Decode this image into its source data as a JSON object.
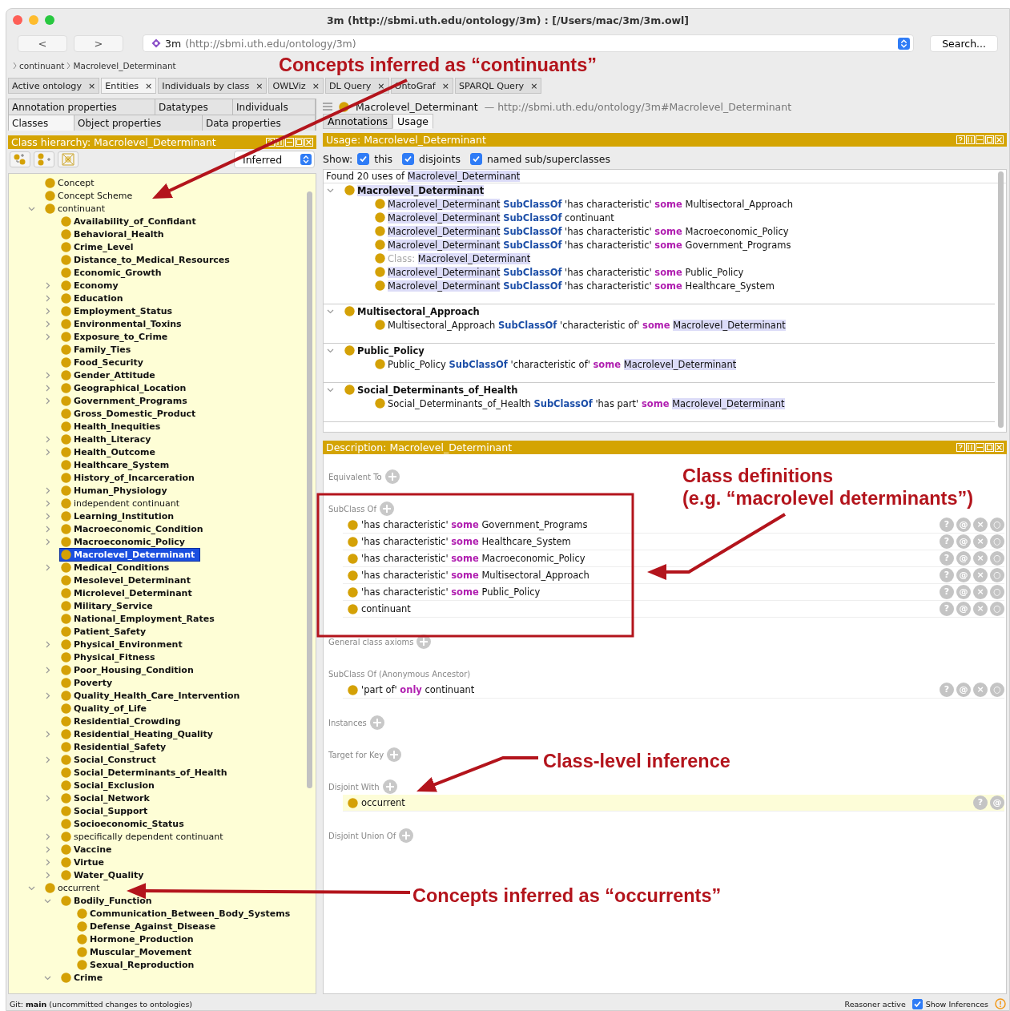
{
  "window": {
    "title": "3m (http://sbmi.uth.edu/ontology/3m)  : [/Users/mac/3m/3m.owl]"
  },
  "toolbar": {
    "back": "<",
    "forward": ">",
    "ontology_name": "3m",
    "ontology_iri": "(http://sbmi.uth.edu/ontology/3m)",
    "search": "Search..."
  },
  "breadcrumb": [
    "continuant",
    "Macrolevel_Determinant"
  ],
  "tabs": [
    {
      "label": "Active ontology",
      "close": "×",
      "selected": false
    },
    {
      "label": "Entities",
      "close": "×",
      "selected": true
    },
    {
      "label": "Individuals by class",
      "close": "×",
      "selected": false
    },
    {
      "label": "OWLViz",
      "close": "×",
      "selected": false
    },
    {
      "label": "DL Query",
      "close": "×",
      "selected": false
    },
    {
      "label": "OntoGraf",
      "close": "×",
      "selected": false
    },
    {
      "label": "SPARQL Query",
      "close": "×",
      "selected": false
    }
  ],
  "left_panel": {
    "tab_rows": [
      [
        {
          "label": "Annotation properties",
          "selected": false
        },
        {
          "label": "Datatypes",
          "selected": false
        },
        {
          "label": "Individuals",
          "selected": false
        }
      ],
      [
        {
          "label": "Classes",
          "selected": true
        },
        {
          "label": "Object properties",
          "selected": false
        },
        {
          "label": "Data properties",
          "selected": false
        }
      ]
    ],
    "title": "Class hierarchy: Macrolevel_Determinant",
    "mode": "Inferred",
    "tree": [
      {
        "label": "Concept",
        "kind": "imported",
        "selected": false
      },
      {
        "label": "Concept Scheme",
        "kind": "imported",
        "selected": false
      },
      {
        "label": "continuant",
        "kind": "imported",
        "selected": false,
        "expanded": true,
        "children": [
          {
            "label": "Availability_of_Confidant",
            "kind": "named",
            "selected": false
          },
          {
            "label": "Behavioral_Health",
            "kind": "named",
            "selected": false
          },
          {
            "label": "Crime_Level",
            "kind": "named",
            "selected": false
          },
          {
            "label": "Distance_to_Medical_Resources",
            "kind": "named",
            "selected": false
          },
          {
            "label": "Economic_Growth",
            "kind": "named",
            "selected": false
          },
          {
            "label": "Economy",
            "kind": "named",
            "selected": false,
            "expanded": false
          },
          {
            "label": "Education",
            "kind": "named",
            "selected": false,
            "expanded": false
          },
          {
            "label": "Employment_Status",
            "kind": "named",
            "selected": false,
            "expanded": false
          },
          {
            "label": "Environmental_Toxins",
            "kind": "named",
            "selected": false,
            "expanded": false
          },
          {
            "label": "Exposure_to_Crime",
            "kind": "named",
            "selected": false,
            "expanded": false
          },
          {
            "label": "Family_Ties",
            "kind": "named",
            "selected": false
          },
          {
            "label": "Food_Security",
            "kind": "named",
            "selected": false
          },
          {
            "label": "Gender_Attitude",
            "kind": "named",
            "selected": false,
            "expanded": false
          },
          {
            "label": "Geographical_Location",
            "kind": "named",
            "selected": false,
            "expanded": false
          },
          {
            "label": "Government_Programs",
            "kind": "named",
            "selected": false,
            "expanded": false
          },
          {
            "label": "Gross_Domestic_Product",
            "kind": "named",
            "selected": false
          },
          {
            "label": "Health_Inequities",
            "kind": "named",
            "selected": false
          },
          {
            "label": "Health_Literacy",
            "kind": "named",
            "selected": false,
            "expanded": false
          },
          {
            "label": "Health_Outcome",
            "kind": "named",
            "selected": false,
            "expanded": false
          },
          {
            "label": "Healthcare_System",
            "kind": "named",
            "selected": false
          },
          {
            "label": "History_of_Incarceration",
            "kind": "named",
            "selected": false
          },
          {
            "label": "Human_Physiology",
            "kind": "named",
            "selected": false,
            "expanded": false
          },
          {
            "label": "independent continuant",
            "kind": "imported",
            "selected": false,
            "expanded": false
          },
          {
            "label": "Learning_Institution",
            "kind": "named",
            "selected": false,
            "expanded": false
          },
          {
            "label": "Macroeconomic_Condition",
            "kind": "named",
            "selected": false,
            "expanded": false
          },
          {
            "label": "Macroeconomic_Policy",
            "kind": "named",
            "selected": false,
            "expanded": false
          },
          {
            "label": "Macrolevel_Determinant",
            "kind": "named",
            "selected": true
          },
          {
            "label": "Medical_Conditions",
            "kind": "named",
            "selected": false,
            "expanded": false
          },
          {
            "label": "Mesolevel_Determinant",
            "kind": "named",
            "selected": false
          },
          {
            "label": "Microlevel_Determinant",
            "kind": "named",
            "selected": false
          },
          {
            "label": "Military_Service",
            "kind": "named",
            "selected": false
          },
          {
            "label": "National_Employment_Rates",
            "kind": "named",
            "selected": false
          },
          {
            "label": "Patient_Safety",
            "kind": "named",
            "selected": false
          },
          {
            "label": "Physical_Environment",
            "kind": "named",
            "selected": false,
            "expanded": false
          },
          {
            "label": "Physical_Fitness",
            "kind": "named",
            "selected": false
          },
          {
            "label": "Poor_Housing_Condition",
            "kind": "named",
            "selected": false,
            "expanded": false
          },
          {
            "label": "Poverty",
            "kind": "named",
            "selected": false
          },
          {
            "label": "Quality_Health_Care_Intervention",
            "kind": "named",
            "selected": false,
            "expanded": false
          },
          {
            "label": "Quality_of_Life",
            "kind": "named",
            "selected": false
          },
          {
            "label": "Residential_Crowding",
            "kind": "named",
            "selected": false
          },
          {
            "label": "Residential_Heating_Quality",
            "kind": "named",
            "selected": false,
            "expanded": false
          },
          {
            "label": "Residential_Safety",
            "kind": "named",
            "selected": false
          },
          {
            "label": "Social_Construct",
            "kind": "named",
            "selected": false,
            "expanded": false
          },
          {
            "label": "Social_Determinants_of_Health",
            "kind": "named",
            "selected": false
          },
          {
            "label": "Social_Exclusion",
            "kind": "named",
            "selected": false
          },
          {
            "label": "Social_Network",
            "kind": "named",
            "selected": false,
            "expanded": false
          },
          {
            "label": "Social_Support",
            "kind": "named",
            "selected": false
          },
          {
            "label": "Socioeconomic_Status",
            "kind": "named",
            "selected": false
          },
          {
            "label": "specifically dependent continuant",
            "kind": "imported",
            "selected": false,
            "expanded": false
          },
          {
            "label": "Vaccine",
            "kind": "named",
            "selected": false,
            "expanded": false
          },
          {
            "label": "Virtue",
            "kind": "named",
            "selected": false,
            "expanded": false
          },
          {
            "label": "Water_Quality",
            "kind": "named",
            "selected": false,
            "expanded": false
          }
        ]
      },
      {
        "label": "occurrent",
        "kind": "imported",
        "selected": false,
        "expanded": true,
        "children": [
          {
            "label": "Bodily_Function",
            "kind": "named",
            "selected": false,
            "expanded": true,
            "children": [
              {
                "label": "Communication_Between_Body_Systems",
                "kind": "named",
                "selected": false
              },
              {
                "label": "Defense_Against_Disease",
                "kind": "named",
                "selected": false
              },
              {
                "label": "Hormone_Production",
                "kind": "named",
                "selected": false
              },
              {
                "label": "Muscular_Movement",
                "kind": "named",
                "selected": false
              },
              {
                "label": "Sexual_Reproduction",
                "kind": "named",
                "selected": false
              }
            ]
          },
          {
            "label": "Crime",
            "kind": "named",
            "selected": false,
            "expanded": true
          }
        ]
      }
    ]
  },
  "entity_header": {
    "name": "Macrolevel_Determinant",
    "iri": "— http://sbmi.uth.edu/ontology/3m#Macrolevel_Determinant"
  },
  "right_tabs": [
    {
      "label": "Annotations",
      "selected": false
    },
    {
      "label": "Usage",
      "selected": true
    }
  ],
  "usage": {
    "title": "Usage: Macrolevel_Determinant",
    "show_label": "Show:",
    "filters": [
      {
        "label": "this",
        "checked": true
      },
      {
        "label": "disjoints",
        "checked": true
      },
      {
        "label": "named sub/superclasses",
        "checked": true
      }
    ],
    "summary": [
      {
        "kind": "text",
        "text": "Found 20 uses of"
      },
      {
        "kind": "entity",
        "text": "Macrolevel_Determinant"
      }
    ],
    "groups": [
      {
        "header": {
          "kind": "entity",
          "text": "Macrolevel_Determinant"
        },
        "expanded": true,
        "axioms": [
          [
            {
              "kind": "entity",
              "text": "Macrolevel_Determinant"
            },
            {
              "kind": "keyword",
              "text": "SubClassOf"
            },
            {
              "kind": "text",
              "text": "'has characteristic'"
            },
            {
              "kind": "quantifier",
              "text": "some"
            },
            {
              "kind": "text",
              "text": "Multisectoral_Approach"
            }
          ],
          [
            {
              "kind": "entity",
              "text": "Macrolevel_Determinant"
            },
            {
              "kind": "keyword",
              "text": "SubClassOf"
            },
            {
              "kind": "text",
              "text": "continuant"
            }
          ],
          [
            {
              "kind": "entity",
              "text": "Macrolevel_Determinant"
            },
            {
              "kind": "keyword",
              "text": "SubClassOf"
            },
            {
              "kind": "text",
              "text": "'has characteristic'"
            },
            {
              "kind": "quantifier",
              "text": "some"
            },
            {
              "kind": "text",
              "text": "Macroeconomic_Policy"
            }
          ],
          [
            {
              "kind": "entity",
              "text": "Macrolevel_Determinant"
            },
            {
              "kind": "keyword",
              "text": "SubClassOf"
            },
            {
              "kind": "text",
              "text": "'has characteristic'"
            },
            {
              "kind": "quantifier",
              "text": "some"
            },
            {
              "kind": "text",
              "text": "Government_Programs"
            }
          ],
          [
            {
              "kind": "label",
              "text": "Class:"
            },
            {
              "kind": "entity",
              "text": "Macrolevel_Determinant"
            }
          ],
          [
            {
              "kind": "entity",
              "text": "Macrolevel_Determinant"
            },
            {
              "kind": "keyword",
              "text": "SubClassOf"
            },
            {
              "kind": "text",
              "text": "'has characteristic'"
            },
            {
              "kind": "quantifier",
              "text": "some"
            },
            {
              "kind": "text",
              "text": "Public_Policy"
            }
          ],
          [
            {
              "kind": "entity",
              "text": "Macrolevel_Determinant"
            },
            {
              "kind": "keyword",
              "text": "SubClassOf"
            },
            {
              "kind": "text",
              "text": "'has characteristic'"
            },
            {
              "kind": "quantifier",
              "text": "some"
            },
            {
              "kind": "text",
              "text": "Healthcare_System"
            }
          ]
        ]
      },
      {
        "header": {
          "kind": "text",
          "text": "Multisectoral_Approach"
        },
        "expanded": true,
        "axioms": [
          [
            {
              "kind": "text",
              "text": "Multisectoral_Approach"
            },
            {
              "kind": "keyword",
              "text": "SubClassOf"
            },
            {
              "kind": "text",
              "text": "'characteristic of'"
            },
            {
              "kind": "quantifier",
              "text": "some"
            },
            {
              "kind": "entity",
              "text": "Macrolevel_Determinant"
            }
          ]
        ]
      },
      {
        "header": {
          "kind": "text",
          "text": "Public_Policy"
        },
        "expanded": true,
        "axioms": [
          [
            {
              "kind": "text",
              "text": "Public_Policy"
            },
            {
              "kind": "keyword",
              "text": "SubClassOf"
            },
            {
              "kind": "text",
              "text": "'characteristic of'"
            },
            {
              "kind": "quantifier",
              "text": "some"
            },
            {
              "kind": "entity",
              "text": "Macrolevel_Determinant"
            }
          ]
        ]
      },
      {
        "header": {
          "kind": "text",
          "text": "Social_Determinants_of_Health"
        },
        "expanded": true,
        "axioms": [
          [
            {
              "kind": "text",
              "text": "Social_Determinants_of_Health"
            },
            {
              "kind": "keyword",
              "text": "SubClassOf"
            },
            {
              "kind": "text",
              "text": "'has part'"
            },
            {
              "kind": "quantifier",
              "text": "some"
            },
            {
              "kind": "entity",
              "text": "Macrolevel_Determinant"
            }
          ]
        ]
      }
    ]
  },
  "description": {
    "title": "Description: Macrolevel_Determinant",
    "sections": [
      {
        "label": "Equivalent To",
        "add": true
      },
      {
        "label": "SubClass Of",
        "add": true,
        "items": [
          {
            "inferred": false,
            "actions": [
              "?",
              "@",
              "×",
              "○"
            ],
            "tokens": [
              {
                "kind": "text",
                "text": "'has characteristic'"
              },
              {
                "kind": "quantifier",
                "text": "some"
              },
              {
                "kind": "text",
                "text": "Government_Programs"
              }
            ]
          },
          {
            "inferred": false,
            "actions": [
              "?",
              "@",
              "×",
              "○"
            ],
            "tokens": [
              {
                "kind": "text",
                "text": "'has characteristic'"
              },
              {
                "kind": "quantifier",
                "text": "some"
              },
              {
                "kind": "text",
                "text": "Healthcare_System"
              }
            ]
          },
          {
            "inferred": false,
            "actions": [
              "?",
              "@",
              "×",
              "○"
            ],
            "tokens": [
              {
                "kind": "text",
                "text": "'has characteristic'"
              },
              {
                "kind": "quantifier",
                "text": "some"
              },
              {
                "kind": "text",
                "text": "Macroeconomic_Policy"
              }
            ]
          },
          {
            "inferred": false,
            "actions": [
              "?",
              "@",
              "×",
              "○"
            ],
            "tokens": [
              {
                "kind": "text",
                "text": "'has characteristic'"
              },
              {
                "kind": "quantifier",
                "text": "some"
              },
              {
                "kind": "text",
                "text": "Multisectoral_Approach"
              }
            ]
          },
          {
            "inferred": false,
            "actions": [
              "?",
              "@",
              "×",
              "○"
            ],
            "tokens": [
              {
                "kind": "text",
                "text": "'has characteristic'"
              },
              {
                "kind": "quantifier",
                "text": "some"
              },
              {
                "kind": "text",
                "text": "Public_Policy"
              }
            ]
          },
          {
            "inferred": false,
            "actions": [
              "?",
              "@",
              "×",
              "○"
            ],
            "tokens": [
              {
                "kind": "text",
                "text": "continuant"
              }
            ]
          }
        ]
      },
      {
        "label": "General class axioms",
        "add": true
      },
      {
        "label": "SubClass Of (Anonymous Ancestor)",
        "add": false,
        "items": [
          {
            "inferred": false,
            "actions": [
              "?",
              "@",
              "×",
              "○"
            ],
            "tokens": [
              {
                "kind": "text",
                "text": "'part of'"
              },
              {
                "kind": "quantifier",
                "text": "only"
              },
              {
                "kind": "text",
                "text": "continuant"
              }
            ]
          }
        ]
      },
      {
        "label": "Instances",
        "add": true
      },
      {
        "label": "Target for Key",
        "add": true
      },
      {
        "label": "Disjoint With",
        "add": true,
        "items": [
          {
            "inferred": true,
            "actions": [
              "?",
              "@"
            ],
            "tokens": [
              {
                "kind": "text",
                "text": "occurrent"
              }
            ]
          }
        ]
      },
      {
        "label": "Disjoint Union Of",
        "add": true
      }
    ]
  },
  "callouts": [
    {
      "text": "Concepts inferred as “continuants”"
    },
    {
      "text": "Class definitions"
    },
    {
      "text": "(e.g. “macrolevel determinants”)"
    },
    {
      "text": "Class-level inference"
    },
    {
      "text": "Concepts inferred as “occurrents”"
    }
  ],
  "status_bar": {
    "git": "Git: **main** (uncommitted changes to ontologies)",
    "reasoner": "Reasoner active",
    "show_inferences": {
      "label": "Show Inferences",
      "checked": true
    }
  }
}
